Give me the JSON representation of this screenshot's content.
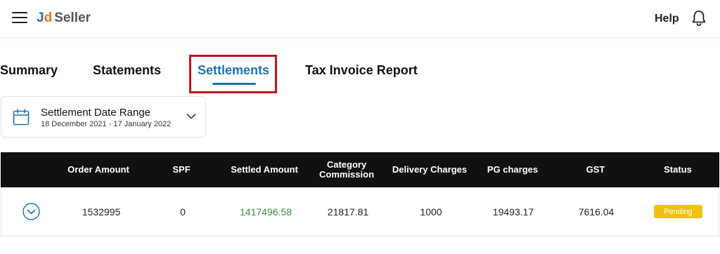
{
  "header": {
    "logo_j": "J",
    "logo_d": "d",
    "logo_seller": "Seller",
    "help_label": "Help"
  },
  "tabs": [
    {
      "label": "Summary"
    },
    {
      "label": "Statements"
    },
    {
      "label": "Settlements",
      "active": true
    },
    {
      "label": "Tax Invoice Report"
    }
  ],
  "date_range": {
    "title": "Settlement Date Range",
    "value": "18 December 2021 - 17 January 2022"
  },
  "table": {
    "columns": {
      "order_amount": "Order Amount",
      "spf": "SPF",
      "settled_amount": "Settled Amount",
      "category_commission_line1": "Category",
      "category_commission_line2": "Commission",
      "delivery_charges": "Delivery Charges",
      "pg_charges": "PG charges",
      "gst": "GST",
      "status": "Status"
    },
    "row": {
      "order_amount": "1532995",
      "spf": "0",
      "settled_amount": "1417496.58",
      "category_commission": "21817.81",
      "delivery_charges": "1000",
      "pg_charges": "19493.17",
      "gst": "7616.04",
      "status": "Pending"
    }
  },
  "colors": {
    "accent": "#1a73b8",
    "logo_d": "#f26c21",
    "settled_text": "#3a8a3a",
    "pending_badge": "#f0c20c",
    "highlight_box": "#c0141b",
    "table_header_bg": "#111111"
  },
  "icons": {
    "menu": "hamburger-menu-icon",
    "notifications": "bell-icon",
    "calendar": "calendar-icon",
    "dropdown": "chevron-down-icon",
    "expand_row": "chevron-down-circle-icon"
  }
}
